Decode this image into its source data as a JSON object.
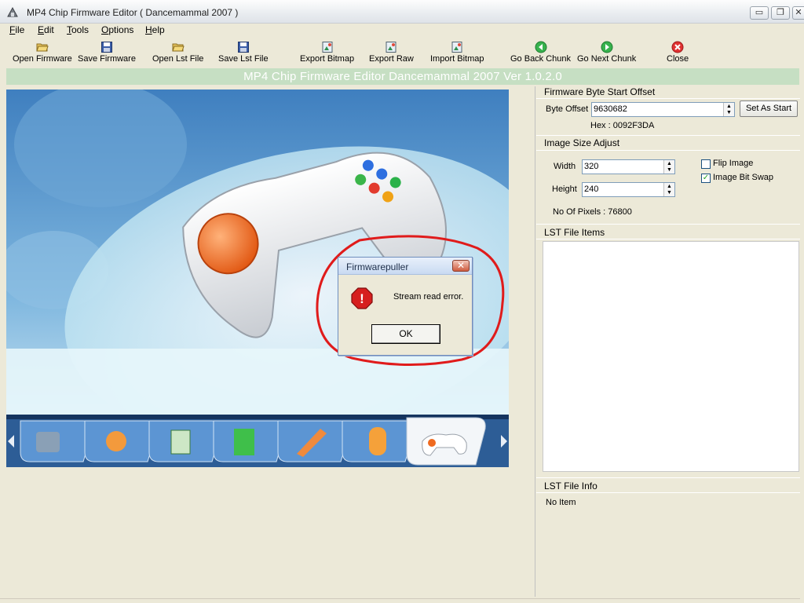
{
  "window": {
    "title": "MP4 Chip Firmware Editor ( Dancemammal 2007 )",
    "controls": {
      "minimize": "▭",
      "restore": "❐",
      "close": "✕"
    }
  },
  "menu": [
    {
      "label": "File",
      "accel": "F",
      "rest": "ile"
    },
    {
      "label": "Edit",
      "accel": "E",
      "rest": "dit"
    },
    {
      "label": "Tools",
      "accel": "T",
      "rest": "ools"
    },
    {
      "label": "Options",
      "accel": "O",
      "rest": "ptions"
    },
    {
      "label": "Help",
      "accel": "H",
      "rest": "elp"
    }
  ],
  "toolbar": {
    "open_firmware": "Open Firmware",
    "save_firmware": "Save Firmware",
    "open_lst": "Open Lst File",
    "save_lst": "Save Lst File",
    "export_bitmap": "Export Bitmap",
    "export_raw": "Export Raw",
    "import_bitmap": "Import Bitmap",
    "go_back": "Go Back Chunk",
    "go_next": "Go Next Chunk",
    "close": "Close"
  },
  "banner": "MP4 Chip Firmware Editor Dancemammal 2007 Ver 1.0.2.0",
  "offset": {
    "group": "Firmware Byte Start Offset",
    "label": "Byte Offset",
    "value": "9630682",
    "hex": "Hex : 0092F3DA",
    "set_button": "Set As Start"
  },
  "size": {
    "group": "Image Size Adjust",
    "width_label": "Width",
    "width": "320",
    "height_label": "Height",
    "height": "240",
    "flip": "Flip Image",
    "bitswap": "Image Bit Swap",
    "bitswap_checked": true,
    "pixels": "No Of Pixels : 76800"
  },
  "lst": {
    "items_label": "LST File Items",
    "info_label": "LST File Info",
    "info_value": "No Item"
  },
  "dialog": {
    "title": "Firmwarepuller",
    "message": "Stream read error.",
    "ok": "OK",
    "close": "✕",
    "icon": "!"
  },
  "colors": {
    "banner": "#c6dfc3",
    "annotation": "#e01b1b",
    "error_red": "#d61f1f"
  }
}
